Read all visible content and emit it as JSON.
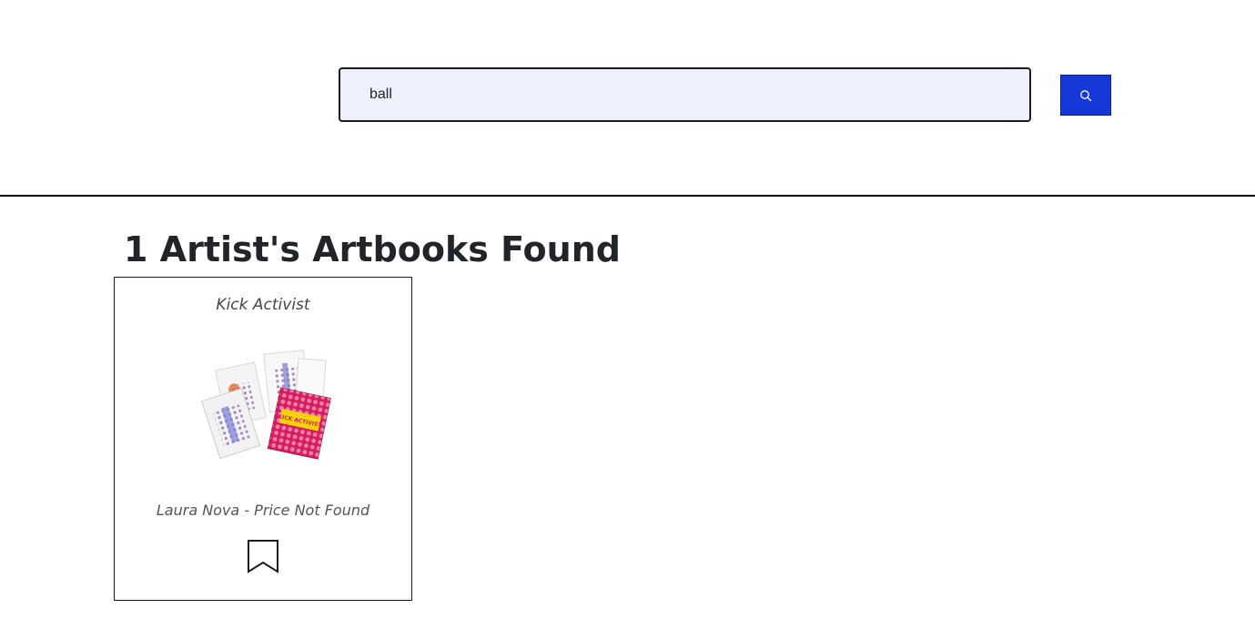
{
  "search": {
    "value": "ball",
    "button_icon": "search-icon"
  },
  "colors": {
    "search_bg": "#eef1fd",
    "search_button": "#1638d8",
    "divider": "#000000"
  },
  "results": {
    "heading": "1 Artist's Artbooks Found"
  },
  "cards": [
    {
      "title": "Kick Activist",
      "artist": "Laura Nova",
      "separator": "-",
      "price": "Price Not Found",
      "meta": "Laura Nova - Price Not Found",
      "image_label": "KICK ACTIVIST",
      "bookmark_icon": "bookmark-icon"
    }
  ]
}
